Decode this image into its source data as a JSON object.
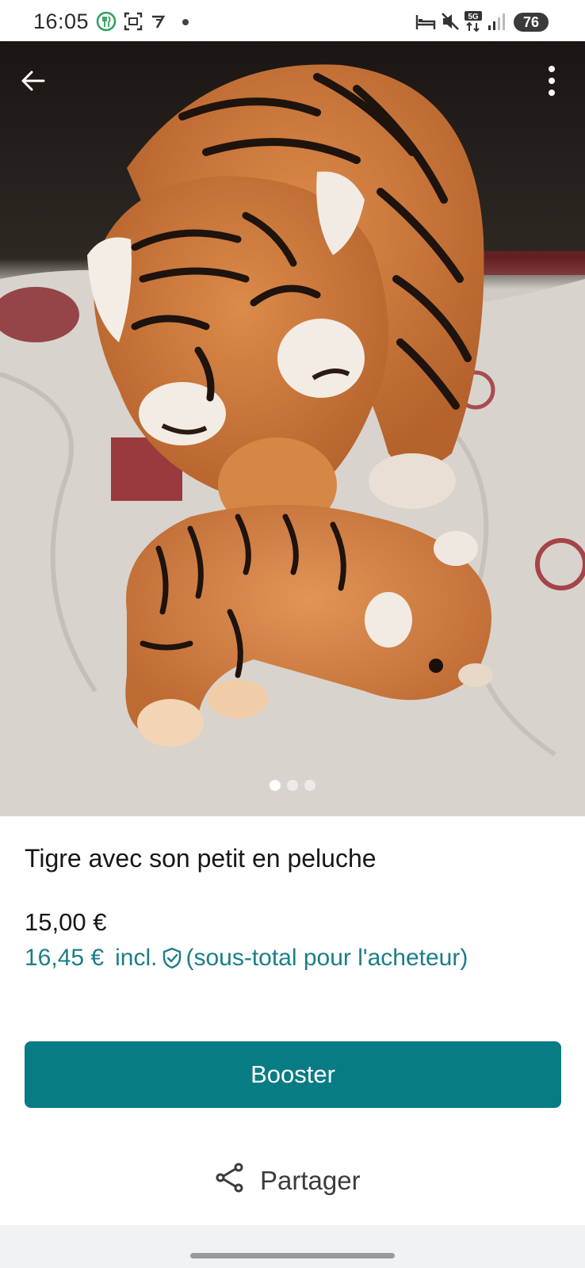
{
  "status_bar": {
    "time": "16:05",
    "icons": [
      "restaurant-notification-icon",
      "screenshot-icon",
      "app-notification-icon",
      "dot-icon",
      "sleep-mode-icon",
      "mute-icon",
      "5g-icon",
      "signal-icon"
    ],
    "network": "5G",
    "battery": "76"
  },
  "photo": {
    "slide_count": 3,
    "active_slide": 1,
    "description_icons": [
      "back-arrow-icon",
      "more-vert-icon"
    ]
  },
  "listing": {
    "title": "Tigre avec son petit en peluche",
    "price": "15,00 €",
    "buyer_price": "16,45 €",
    "buyer_incl": "incl.",
    "buyer_note": "(sous-total pour l'acheteur)"
  },
  "actions": {
    "booster_label": "Booster",
    "share_label": "Partager"
  },
  "colors": {
    "accent": "#087c85",
    "buyer_price_text": "#1a7e86"
  }
}
